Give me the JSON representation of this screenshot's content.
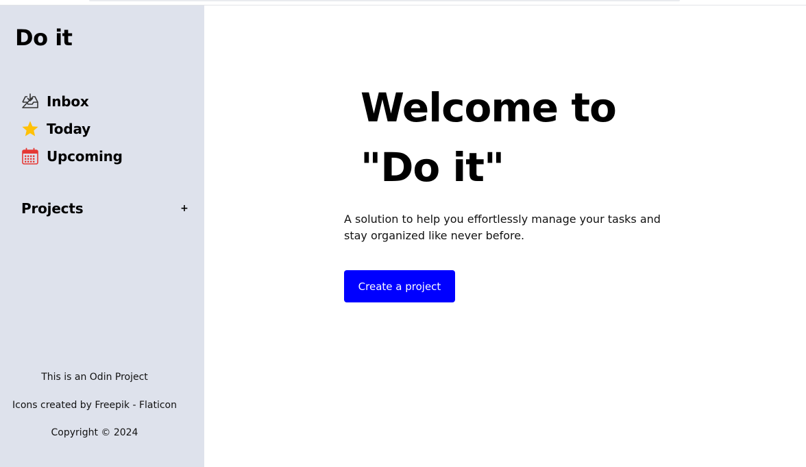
{
  "sidebar": {
    "app_title": "Do it",
    "nav": [
      {
        "label": "Inbox",
        "icon": "inbox-icon"
      },
      {
        "label": "Today",
        "icon": "star-icon"
      },
      {
        "label": "Upcoming",
        "icon": "calendar-icon"
      }
    ],
    "projects": {
      "title": "Projects",
      "add_label": "+"
    },
    "footer": {
      "line1": "This is an Odin Project",
      "line2": "Icons created by Freepik - Flaticon",
      "line3": "Copyright © 2024"
    }
  },
  "main": {
    "welcome_line1": "Welcome to",
    "welcome_line2": "\"Do it\"",
    "subtitle": "A solution to help you effortlessly manage your tasks and stay organized like never before.",
    "cta_label": "Create a project"
  },
  "colors": {
    "sidebar_bg": "#dee2ec",
    "accent": "#0000ff",
    "star": "#ffc107",
    "calendar": "#e53935"
  }
}
